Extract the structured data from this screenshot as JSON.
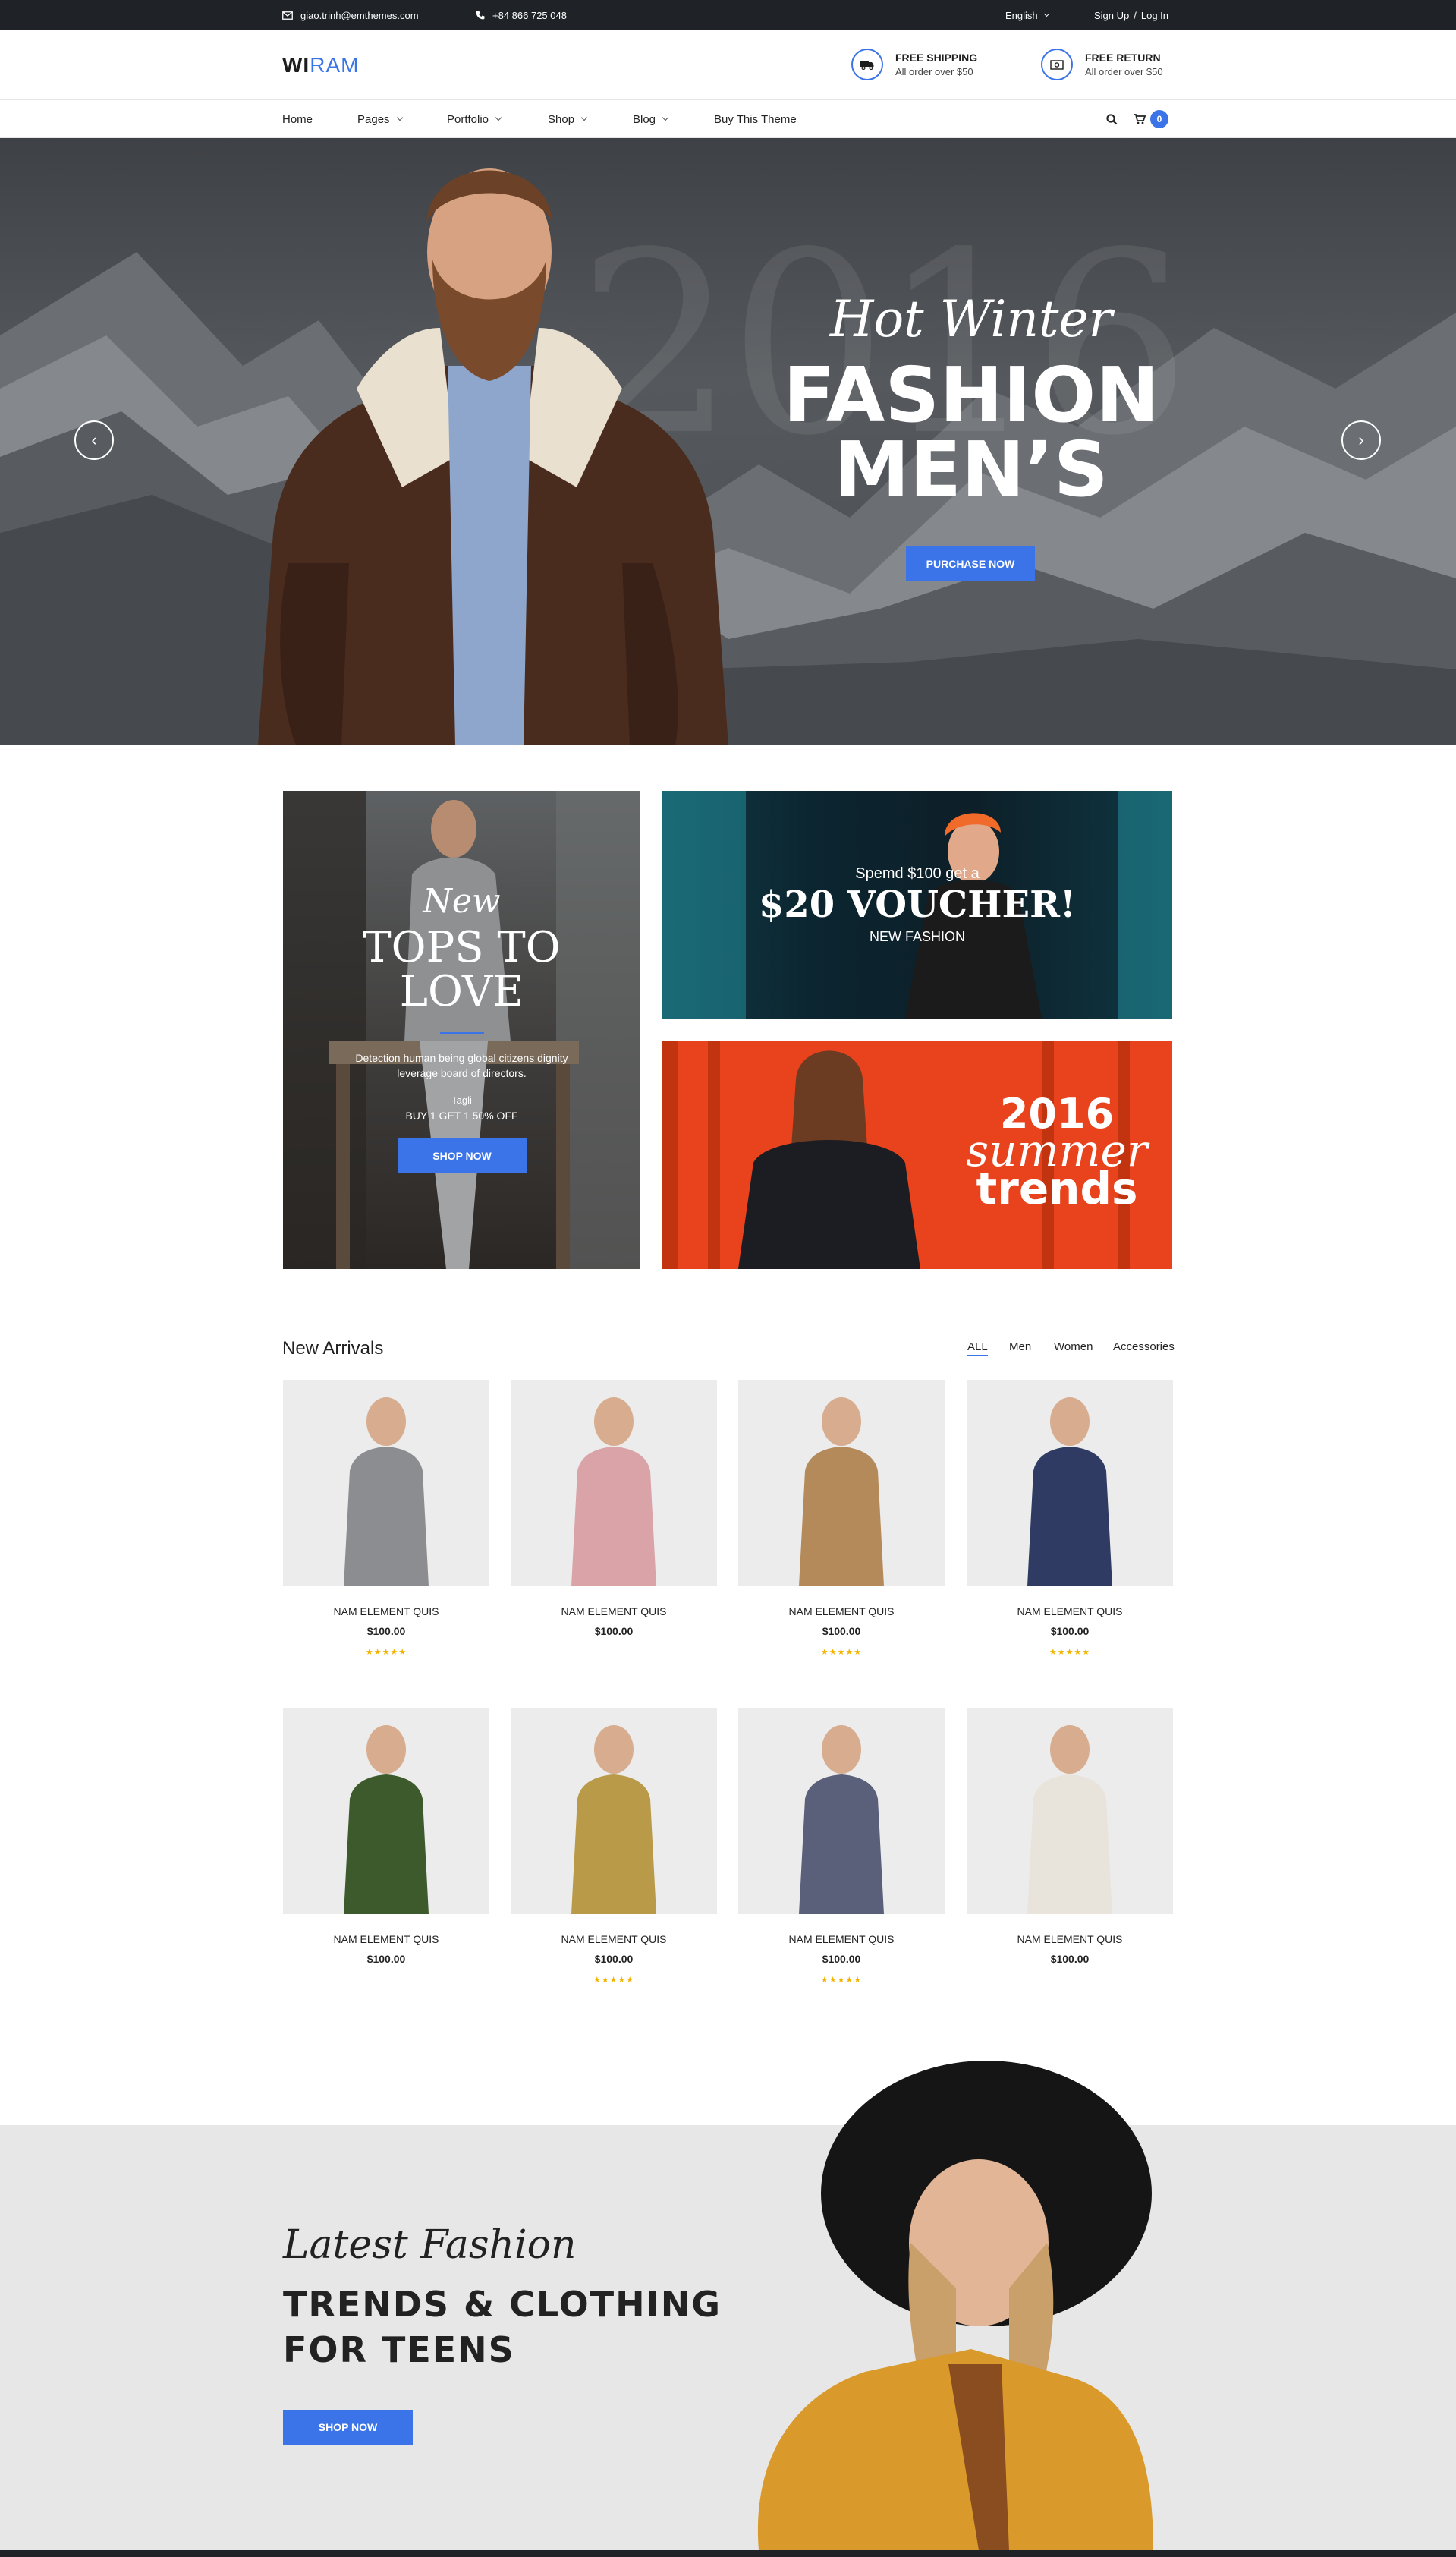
{
  "topbar": {
    "email": "giao.trinh@emthemes.com",
    "phone": "+84 866 725 048",
    "language": "English",
    "sign_up": "Sign Up",
    "separator": "/",
    "log_in": "Log In",
    "icons": [
      "mail-icon",
      "phone-icon"
    ]
  },
  "header": {
    "logo_bold": "WI",
    "logo_thin": "RAM",
    "features": [
      {
        "icon": "truck-icon",
        "title": "FREE SHIPPING",
        "subtitle": "All order over $50"
      },
      {
        "icon": "return-icon",
        "title": "FREE RETURN",
        "subtitle": "All order over $50"
      }
    ],
    "cart_count": "0"
  },
  "nav": {
    "items": [
      {
        "label": "Home",
        "dropdown": false
      },
      {
        "label": "Pages",
        "dropdown": true
      },
      {
        "label": "Portfolio",
        "dropdown": true
      },
      {
        "label": "Shop",
        "dropdown": true
      },
      {
        "label": "Blog",
        "dropdown": true
      },
      {
        "label": "Buy This Theme",
        "dropdown": false
      }
    ]
  },
  "hero": {
    "year": "2016",
    "script": "Hot Winter",
    "title_line1": "FASHION",
    "title_line2": "MEN’S",
    "button": "PURCHASE NOW",
    "prev": "‹",
    "next": "›"
  },
  "promo_left": {
    "script": "New",
    "title_line1": "TOPS TO",
    "title_line2": "LOVE",
    "desc_line1": "Detection human being global citizens dignity",
    "desc_line2": "leverage board of directors.",
    "tag": "Tagli",
    "offer": "BUY 1 GET 1 50% OFF",
    "button": "SHOP NOW"
  },
  "promo_voucher": {
    "line1": "Spemd $100 get a",
    "line2": "$20 VOUCHER!",
    "line3": "NEW FASHION"
  },
  "promo_summer": {
    "year": "2016",
    "script": "summer",
    "word": "trends"
  },
  "arrivals": {
    "title": "New Arrivals",
    "filters": [
      "ALL",
      "Men",
      "Women",
      "Accessories"
    ],
    "active_filter": "ALL",
    "products": [
      {
        "name": "NAM ELEMENT QUIS",
        "price": "$100.00",
        "rating": 5,
        "stars": "★★★★★"
      },
      {
        "name": "NAM ELEMENT QUIS",
        "price": "$100.00",
        "rating": 0,
        "stars": ""
      },
      {
        "name": "NAM ELEMENT QUIS",
        "price": "$100.00",
        "rating": 5,
        "stars": "★★★★★"
      },
      {
        "name": "NAM ELEMENT QUIS",
        "price": "$100.00",
        "rating": 5,
        "stars": "★★★★★"
      },
      {
        "name": "NAM ELEMENT QUIS",
        "price": "$100.00",
        "rating": 0,
        "stars": ""
      },
      {
        "name": "NAM ELEMENT QUIS",
        "price": "$100.00",
        "rating": 5,
        "stars": "★★★★★"
      },
      {
        "name": "NAM ELEMENT QUIS",
        "price": "$100.00",
        "rating": 5,
        "stars": "★★★★★"
      },
      {
        "name": "NAM ELEMENT QUIS",
        "price": "$100.00",
        "rating": 0,
        "stars": ""
      }
    ]
  },
  "latest": {
    "script": "Latest Fashion",
    "title_line1": "TRENDS & CLOTHING",
    "title_line2": "FOR TEENS",
    "button": "SHOP NOW"
  },
  "colors": {
    "accent": "#3b74e8",
    "dark": "#1f2327",
    "star": "#f0b400",
    "summer_bg": "#e8431c"
  }
}
